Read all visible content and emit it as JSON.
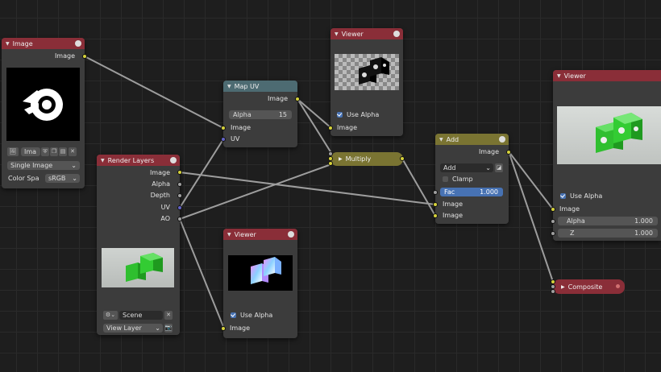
{
  "nodes": {
    "image": {
      "title": "Image",
      "out_image": "Image",
      "name_field": "Ima",
      "source": "Single Image",
      "colorspace_label": "Color Spa",
      "colorspace_value": "sRGB"
    },
    "render_layers": {
      "title": "Render Layers",
      "outputs": [
        "Image",
        "Alpha",
        "Depth",
        "UV",
        "AO"
      ],
      "scene": "Scene",
      "view_layer": "View Layer"
    },
    "map_uv": {
      "title": "Map UV",
      "out_image": "Image",
      "alpha_label": "Alpha",
      "alpha_value": "15",
      "in_image": "Image",
      "in_uv": "UV"
    },
    "viewer_top": {
      "title": "Viewer",
      "use_alpha": "Use Alpha",
      "in_image": "Image"
    },
    "multiply": {
      "title": "Multiply"
    },
    "add": {
      "title": "Add",
      "out_image": "Image",
      "blend_mode": "Add",
      "clamp": "Clamp",
      "fac_label": "Fac",
      "fac_value": "1.000",
      "in_image1": "Image",
      "in_image2": "Image"
    },
    "viewer_bottom": {
      "title": "Viewer",
      "use_alpha": "Use Alpha",
      "in_image": "Image"
    },
    "viewer_right": {
      "title": "Viewer",
      "use_alpha": "Use Alpha",
      "in_image": "Image",
      "alpha_label": "Alpha",
      "alpha_value": "1.000",
      "z_label": "Z",
      "z_value": "1.000"
    },
    "composite": {
      "title": "Composite"
    }
  },
  "colors": {
    "header_output": "#8a2e38",
    "header_converter": "#4d6b72",
    "header_color": "#7a7432",
    "socket_color": "#d6d23b",
    "socket_float": "#a0a0a0",
    "socket_vector": "#6363c7",
    "wire": "#b4b4b4"
  }
}
